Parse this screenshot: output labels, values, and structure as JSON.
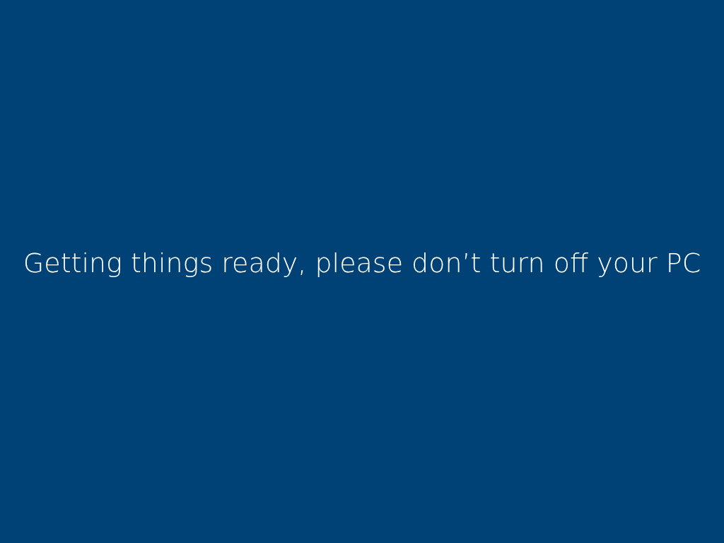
{
  "screen": {
    "message": "Getting things ready, please don’t turn off your PC"
  }
}
